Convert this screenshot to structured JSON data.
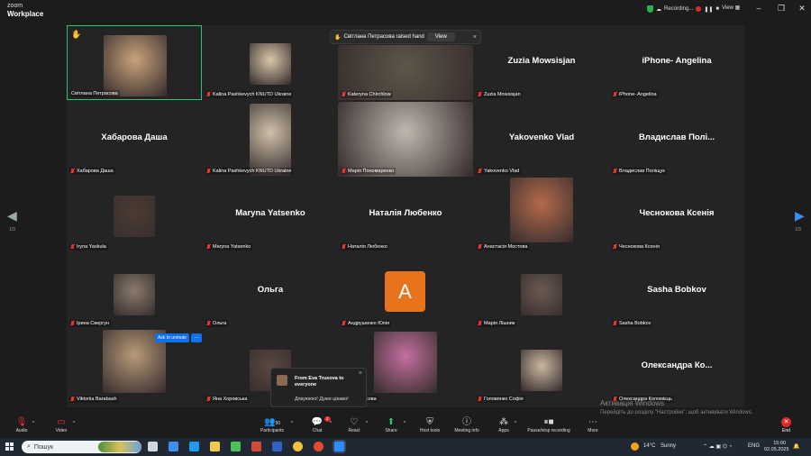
{
  "app": {
    "brand_top": "zoom",
    "brand_bottom": "Workplace"
  },
  "titlebar": {
    "recording": "Recording...",
    "view": "View",
    "minimize": "–",
    "maximize": "❐",
    "close": "✕"
  },
  "notification": {
    "text": "Світлана Петрасова raised hand",
    "view_button": "View",
    "close": "×"
  },
  "tiles": [
    {
      "name": "Світлана Петрасова",
      "type": "photo",
      "active": true,
      "raised_hand": true,
      "photo_color": "#c9a27a"
    },
    {
      "name": "Kalina Pashkevych KNUTD Ukraine",
      "type": "photo",
      "photo_color": "#d9c7a8"
    },
    {
      "name": "Kateryna Chirchlow",
      "type": "photo",
      "photo_color": "#5d5648"
    },
    {
      "name": "Zuzia Mowsisjan",
      "type": "name"
    },
    {
      "name": "iPhone- Angelina",
      "type": "name"
    },
    {
      "name": "Хабарова Даша",
      "type": "name"
    },
    {
      "name": "Kalina Pashkevych KNUTD Ukraine",
      "type": "photo",
      "photo_color": "#cfc1aa"
    },
    {
      "name": "Марія Пономаренко",
      "type": "photo",
      "photo_color": "#bfb6ae"
    },
    {
      "name": "Yakovenko Vlad",
      "type": "name"
    },
    {
      "name": "Владислав Полі...",
      "label": "Владислав Поліщук",
      "type": "name"
    },
    {
      "name": "Iryna Yaskula",
      "type": "photo",
      "photo_color": "#4b3a30"
    },
    {
      "name": "Maryna Yatsenko",
      "type": "name"
    },
    {
      "name": "Наталія Любенко",
      "type": "name"
    },
    {
      "name": "Анастасія Мостова",
      "type": "photo",
      "photo_color": "#b5694a"
    },
    {
      "name": "Чеснокова Ксенія",
      "type": "name"
    },
    {
      "name": "Ірина Свергун",
      "type": "photo",
      "photo_color": "#8a7b6b"
    },
    {
      "name": "Ольга",
      "type": "name"
    },
    {
      "name": "Андрушенко Юлія",
      "type": "avatar",
      "letter": "A"
    },
    {
      "name": "Марія Лішник",
      "type": "photo",
      "photo_color": "#6b5a52"
    },
    {
      "name": "Sasha Bobkov",
      "type": "name"
    },
    {
      "name": "Viktoriia Barabash",
      "type": "photo",
      "photo_color": "#b89a78"
    },
    {
      "name": "Яна Хоровська",
      "type": "photo",
      "photo_color": "#5a4840"
    },
    {
      "name": "Ева Трусова",
      "type": "photo",
      "photo_color": "#c56fa0"
    },
    {
      "name": "Головянко Софія",
      "type": "photo",
      "photo_color": "#c9b7a0"
    },
    {
      "name": "Олександра Ко...",
      "label": "Олександра Коломієць",
      "type": "name"
    }
  ],
  "ask_unmute": {
    "label": "Ask to unmute",
    "more": "···"
  },
  "pager": {
    "left": "1/3",
    "right": "1/3"
  },
  "chat_popup": {
    "from": "From Eva Trusova to everyone",
    "message": "Дякуююю! Дуже цікаво!",
    "close": "×"
  },
  "activate_windows": {
    "title": "Активація Windows",
    "subtitle": "Перейдіть до розділу \"Настройки\", щоб активувати Windows."
  },
  "toolbar": {
    "audio": "Audio",
    "video": "Video",
    "participants": "Participants",
    "participants_count": "50",
    "chat": "Chat",
    "chat_badge": "2",
    "react": "React",
    "share": "Share",
    "host_tools": "Host tools",
    "meeting_info": "Meeting info",
    "apps": "Apps",
    "pause_recording": "Pause/stop recording",
    "more": "More",
    "end": "End"
  },
  "taskbar": {
    "search": "Пошук",
    "weather": "14°C",
    "weather_desc": "Sunny",
    "lang": "ENG",
    "time": "15:00",
    "date": "02.05.2025"
  }
}
